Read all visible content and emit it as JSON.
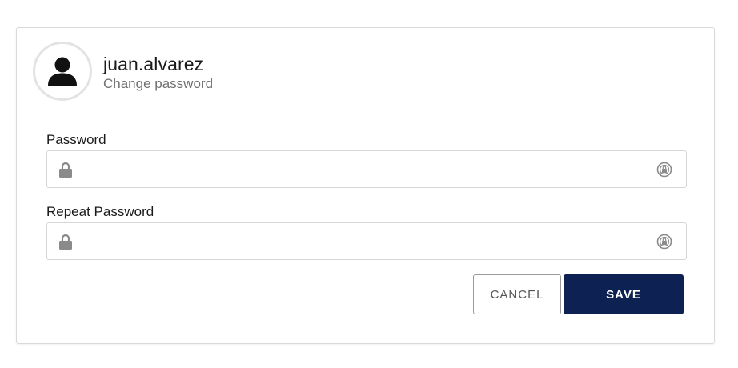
{
  "user": {
    "username": "juan.alvarez",
    "subtitle": "Change password"
  },
  "form": {
    "password_label": "Password",
    "password_value": "",
    "repeat_password_label": "Repeat Password",
    "repeat_password_value": ""
  },
  "actions": {
    "cancel_label": "CANCEL",
    "save_label": "SAVE"
  },
  "icons": {
    "avatar": "user-silhouette-icon",
    "field_prefix": "lock-icon",
    "field_suffix": "reveal-password-icon"
  },
  "colors": {
    "primary": "#0d2153",
    "border": "#d6d6d6",
    "icon": "#8a8a8a"
  }
}
